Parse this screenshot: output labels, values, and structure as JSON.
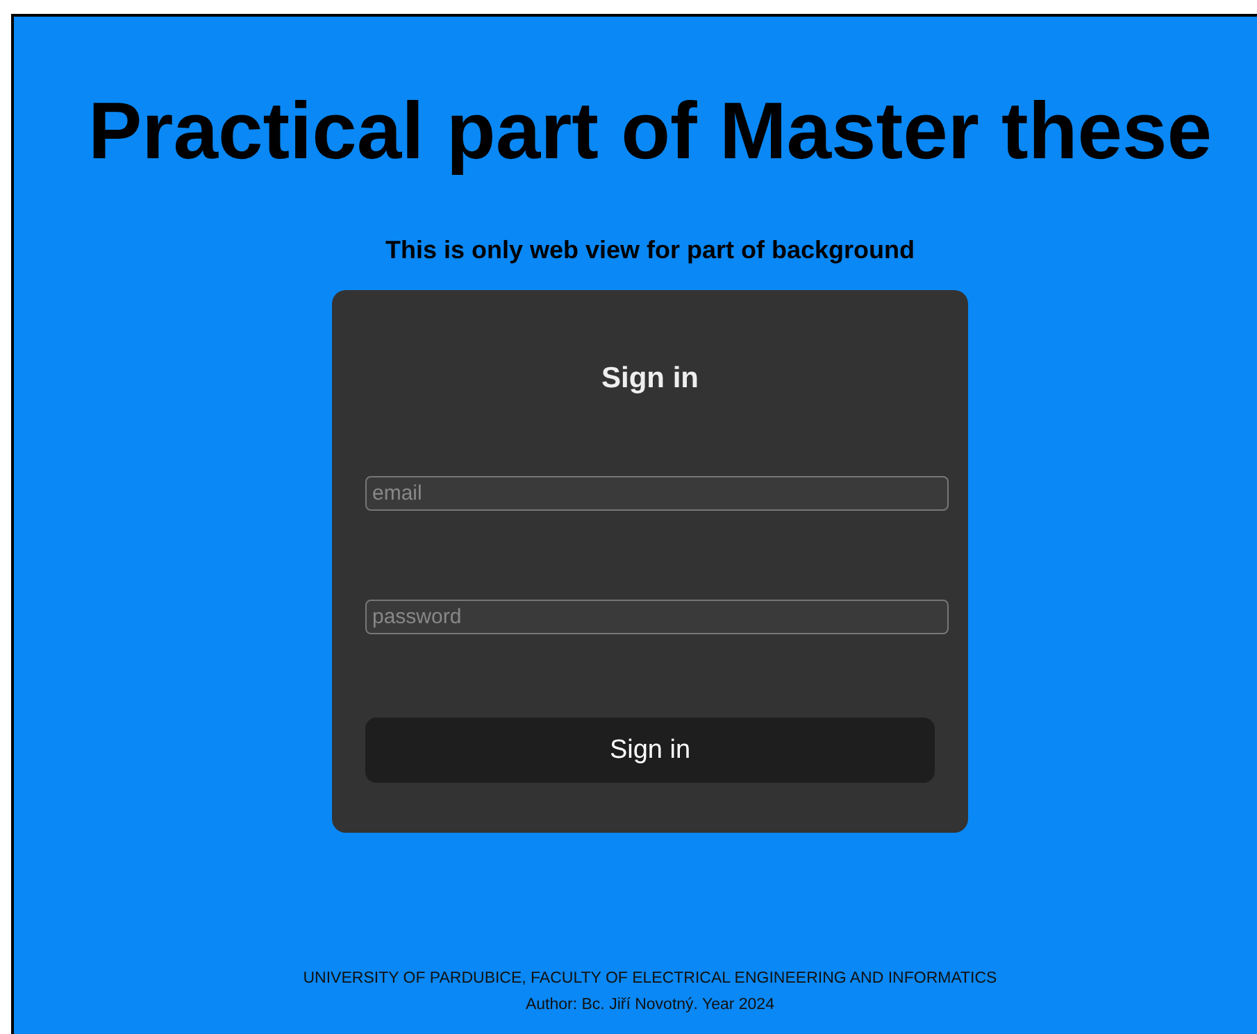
{
  "title": "Practical part of Master these",
  "subtitle": "This is only web view for part of background",
  "form": {
    "heading": "Sign in",
    "fields": [
      {
        "placeholder": "email"
      },
      {
        "placeholder": "password"
      }
    ],
    "button": "Sign in"
  },
  "footer": [
    "UNIVERSITY OF PARDUBICE, FACULTY OF ELECTRICAL ENGINEERING AND INFORMATICS",
    "Author: Bc. Jiří Novotný. Year 2024"
  ]
}
